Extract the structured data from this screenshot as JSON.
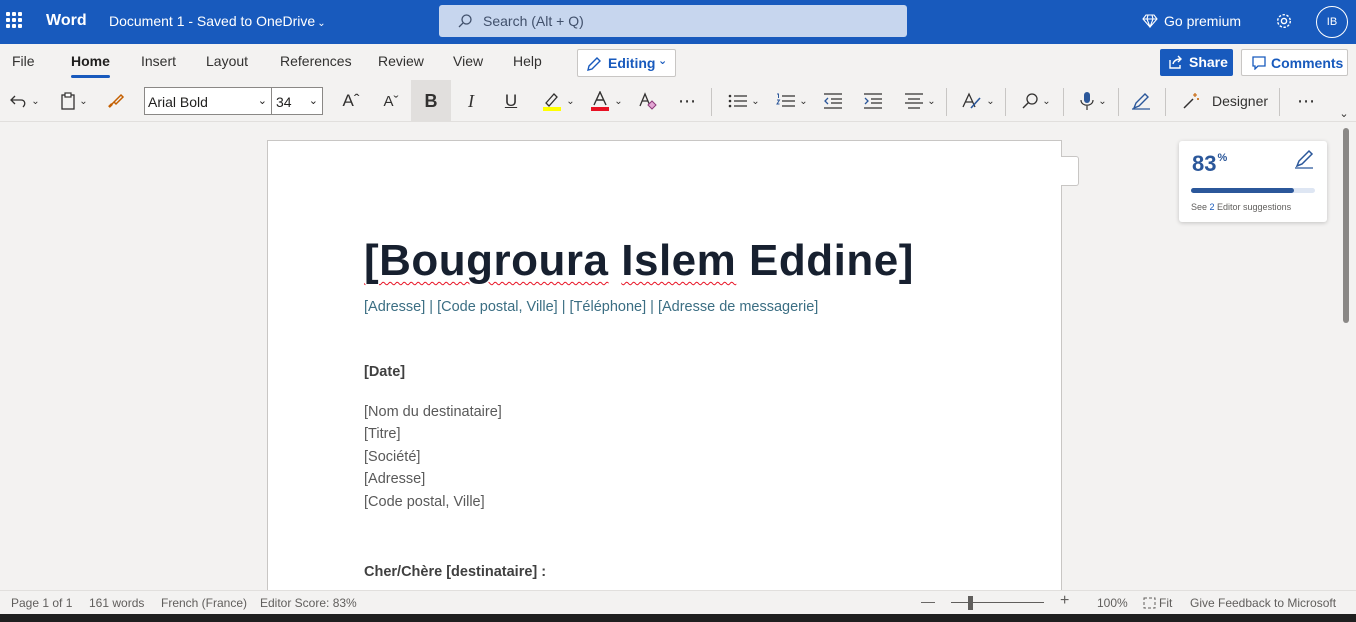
{
  "titlebar": {
    "app_name": "Word",
    "doc_title": "Document 1  -  Saved to OneDrive",
    "search_placeholder": "Search (Alt + Q)",
    "premium_label": "Go premium",
    "avatar_initials": "IB"
  },
  "menu": {
    "tabs": [
      "File",
      "Home",
      "Insert",
      "Layout",
      "References",
      "Review",
      "View",
      "Help"
    ],
    "active_tab": "Home",
    "mode_label": "Editing",
    "share_label": "Share",
    "comments_label": "Comments"
  },
  "ribbon": {
    "font_name": "Arial Bold",
    "font_size": "34",
    "designer_label": "Designer",
    "highlight_color": "#ffff00",
    "font_color": "#e81123"
  },
  "document": {
    "name": "[Bougroura Islem Eddine]",
    "contact": "[Adresse] | [Code postal, Ville] | [Téléphone] | [Adresse de messagerie]",
    "date": "[Date]",
    "recipient_lines": [
      "[Nom du destinataire]",
      "[Titre]",
      "[Société]",
      "[Adresse]",
      "[Code postal, Ville]"
    ],
    "greeting": "Cher/Chère [destinataire] :"
  },
  "editor": {
    "score": "83",
    "score_unit": "%",
    "score_fraction": 0.83,
    "suggestions_prefix": "See ",
    "suggestions_count": "2",
    "suggestions_suffix": " Editor suggestions"
  },
  "status": {
    "page": "Page 1 of 1",
    "words": "161 words",
    "language": "French (France)",
    "editor_score": "Editor Score: 83%",
    "zoom": "100%",
    "fit": "Fit",
    "feedback": "Give Feedback to Microsoft"
  },
  "colors": {
    "brand": "#185abd",
    "editor_accent": "#2b579a"
  }
}
